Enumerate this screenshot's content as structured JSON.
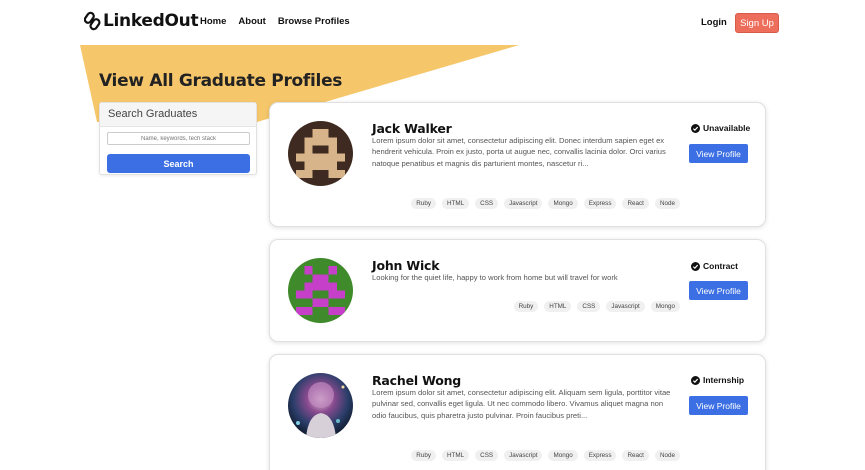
{
  "nav": {
    "brand": "LinkedOut",
    "links": [
      "Home",
      "About",
      "Browse Profiles"
    ],
    "login": "Login",
    "signup": "Sign Up"
  },
  "page_title": "View All Graduate Profiles",
  "search": {
    "heading": "Search Graduates",
    "placeholder": "Name, keywords, tech stack",
    "button": "Search"
  },
  "view_button_label": "View Profile",
  "profiles": [
    {
      "name": "Jack Walker",
      "description": "Lorem ipsum dolor sit amet, consectetur adipiscing elit. Donec interdum sapien eget ex hendrerit vehicula. Proin ex justo, porta ut augue nec, convallis lacinia dolor. Orci varius natoque penatibus et magnis dis parturient montes, nascetur ri...",
      "status": "Unavailable",
      "tags": [
        "Ruby",
        "HTML",
        "CSS",
        "Javascript",
        "Mongo",
        "Express",
        "React",
        "Node"
      ],
      "avatar": "pixel-avatar-brown"
    },
    {
      "name": "John Wick",
      "description": "Looking for the quiet life, happy to work from home but will travel for work",
      "status": "Contract",
      "tags": [
        "Ruby",
        "HTML",
        "CSS",
        "Javascript",
        "Mongo"
      ],
      "avatar": "pixel-avatar-green-magenta"
    },
    {
      "name": "Rachel Wong",
      "description": "Lorem ipsum dolor sit amet, consectetur adipiscing elit. Aliquam sem ligula, porttitor vitae pulvinar sed, convallis eget ligula. Ut nec commodo libero. Vivamus aliquet magna non odio faucibus, quis pharetra justo pulvinar. Proin faucibus preti...",
      "status": "Internship",
      "tags": [
        "Ruby",
        "HTML",
        "CSS",
        "Javascript",
        "Mongo",
        "Express",
        "React",
        "Node"
      ],
      "avatar": "photo-avatar-cosmic"
    }
  ],
  "colors": {
    "banner": "#f6c76a",
    "primary": "#3b6fe3",
    "signup": "#ee6e5c"
  }
}
